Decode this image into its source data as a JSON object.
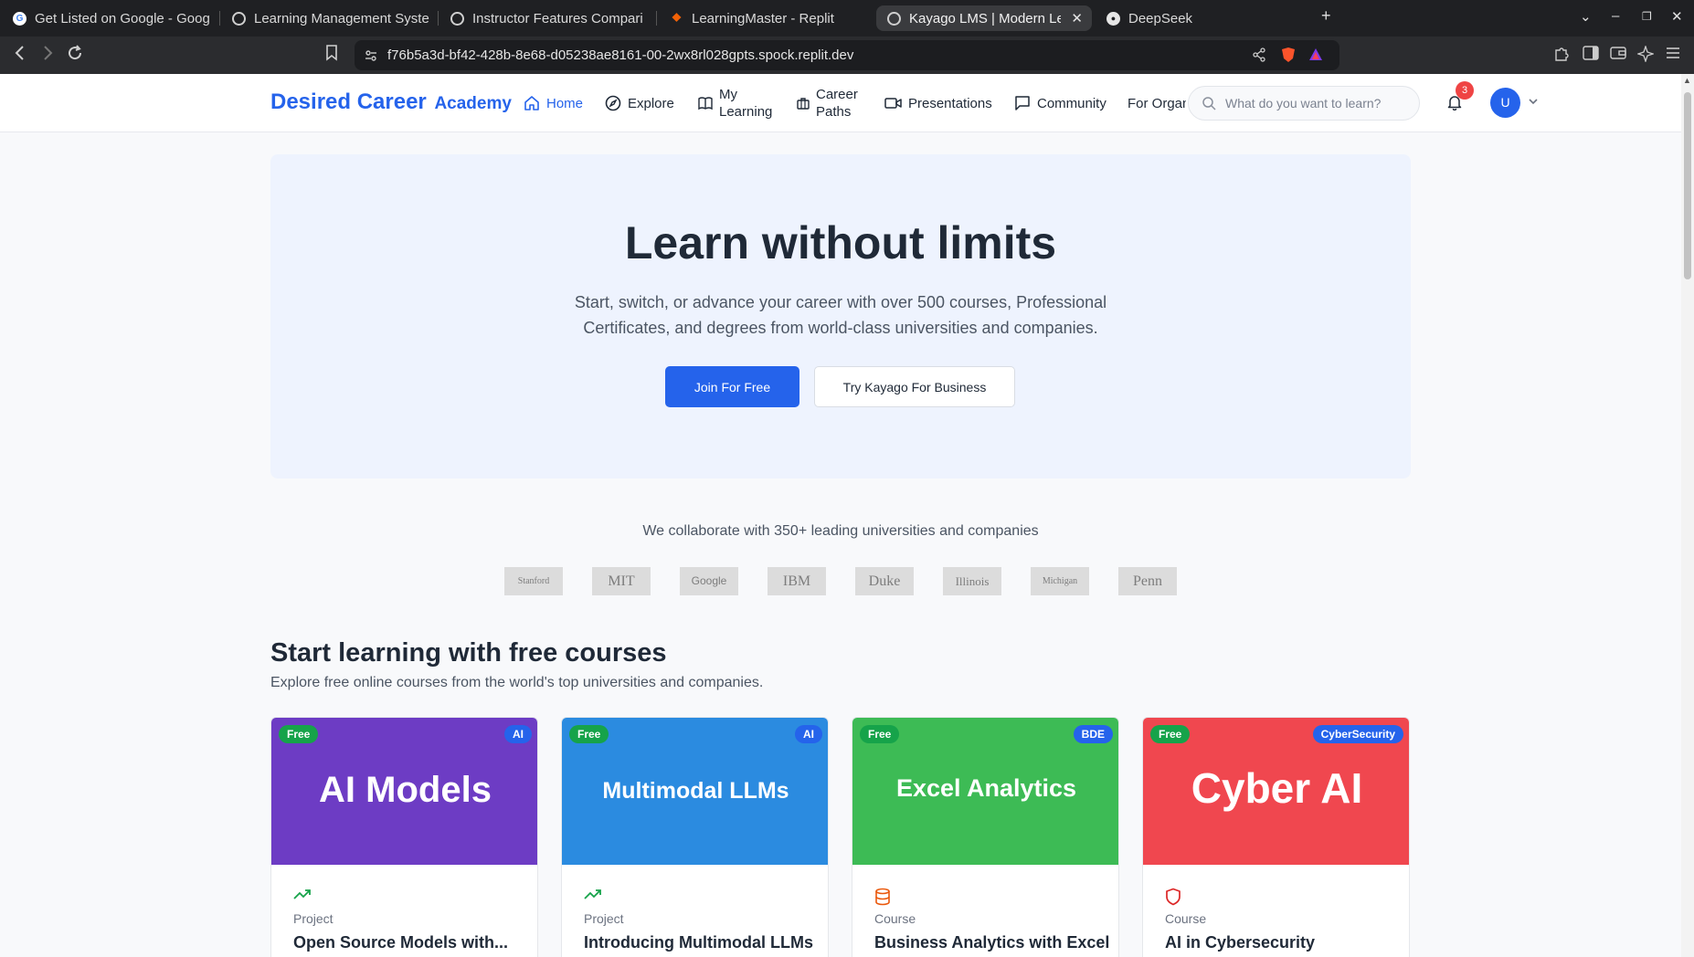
{
  "browser": {
    "tabs": [
      {
        "label": "Get Listed on Google - Goog",
        "icon": "google-icon",
        "active": false
      },
      {
        "label": "Learning Management Syste",
        "icon": "globe-icon",
        "active": false
      },
      {
        "label": "Instructor Features Compari",
        "icon": "globe-icon",
        "active": false
      },
      {
        "label": "LearningMaster - Replit",
        "icon": "replit-icon",
        "active": false
      },
      {
        "label": "Kayago LMS | Modern Le",
        "icon": "globe-icon",
        "active": true
      },
      {
        "label": "DeepSeek",
        "icon": "github-icon",
        "active": false
      }
    ],
    "url": "f76b5a3d-bf42-428b-8e68-d05238ae8161-00-2wx8rl028gpts.spock.replit.dev"
  },
  "header": {
    "brand_primary": "Desired Career",
    "brand_secondary": "Academy",
    "nav": [
      {
        "label": "Home",
        "icon": "home-icon"
      },
      {
        "label": "Explore",
        "icon": "compass-icon"
      },
      {
        "label_line1": "My",
        "label_line2": "Learning",
        "icon": "book-icon"
      },
      {
        "label_line1": "Career",
        "label_line2": "Paths",
        "icon": "briefcase-icon"
      },
      {
        "label": "Presentations",
        "icon": "video-icon"
      },
      {
        "label": "Community",
        "icon": "chat-icon"
      },
      {
        "label": "For Organ"
      }
    ],
    "search_placeholder": "What do you want to learn?",
    "notification_count": "3",
    "avatar_initial": "U"
  },
  "hero": {
    "title": "Learn without limits",
    "subtitle": "Start, switch, or advance your career with over 500 courses, Professional Certificates, and degrees from world-class universities and companies.",
    "primary_button": "Join For Free",
    "secondary_button": "Try Kayago For Business"
  },
  "partners": {
    "heading": "We collaborate with 350+ leading universities and companies",
    "logos": [
      "Stanford",
      "MIT",
      "Google",
      "IBM",
      "Duke",
      "Illinois",
      "Michigan",
      "Penn"
    ]
  },
  "free_courses": {
    "title": "Start learning with free courses",
    "subtitle": "Explore free online courses from the world's top universities and companies.",
    "cards": [
      {
        "banner_text": "AI Models",
        "free_label": "Free",
        "tag": "AI",
        "banner_color": "#6d3cc4",
        "icon": "trending-up-icon",
        "type": "Project",
        "title": "Open Source Models with..."
      },
      {
        "banner_text": "Multimodal LLMs",
        "free_label": "Free",
        "tag": "AI",
        "banner_color": "#2b8be0",
        "icon": "trending-up-icon",
        "type": "Project",
        "title": "Introducing Multimodal LLMs"
      },
      {
        "banner_text": "Excel Analytics",
        "free_label": "Free",
        "tag": "BDE",
        "banner_color": "#3dbb55",
        "icon": "database-icon",
        "type": "Course",
        "title": "Business Analytics with Excel"
      },
      {
        "banner_text": "Cyber AI",
        "free_label": "Free",
        "tag": "CyberSecurity",
        "banner_color": "#f0474f",
        "icon": "shield-icon",
        "type": "Course",
        "title": "AI in Cybersecurity"
      }
    ]
  },
  "colors": {
    "brand": "#2563eb",
    "free_badge": "#16a34a",
    "notification": "#ef4444"
  }
}
